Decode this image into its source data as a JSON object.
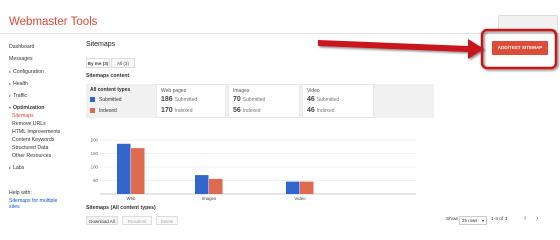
{
  "app": {
    "title": "Webmaster Tools",
    "accent": "#dd4b39",
    "link_color": "#1155cc"
  },
  "sidebar": {
    "items": [
      {
        "label": "Dashboard",
        "kind": "top"
      },
      {
        "label": "Messages",
        "kind": "top"
      },
      {
        "label": "Configuration",
        "kind": "caret"
      },
      {
        "label": "Health",
        "kind": "caret"
      },
      {
        "label": "Traffic",
        "kind": "caret"
      },
      {
        "label": "Optimization",
        "kind": "open"
      },
      {
        "label": "Sitemaps",
        "kind": "sub-active"
      },
      {
        "label": "Remove URLs",
        "kind": "sub"
      },
      {
        "label": "HTML Improvements",
        "kind": "sub"
      },
      {
        "label": "Content Keywords",
        "kind": "sub"
      },
      {
        "label": "Structured Data",
        "kind": "sub"
      },
      {
        "label": "Other Resources",
        "kind": "sub"
      },
      {
        "label": "Labs",
        "kind": "caret"
      }
    ],
    "help_title": "Help with:",
    "help_link": "Sitemaps for multiple sites"
  },
  "main": {
    "title": "Sitemaps",
    "add_button": "ADD/TEST SITEMAP",
    "tabs": [
      {
        "label": "By me (3)",
        "active": true
      },
      {
        "label": "All (3)",
        "active": false
      }
    ],
    "content_label": "Sitemaps content",
    "legend": {
      "header": "All content types",
      "submitted": "Submitted",
      "indexed": "Indexed",
      "submitted_color": "#3366cc",
      "indexed_color": "#dc6b4f"
    },
    "stats": [
      {
        "header": "Web pages",
        "submitted": "186",
        "indexed": "170",
        "submitted_label": "Submitted",
        "indexed_label": "Indexed"
      },
      {
        "header": "Images",
        "submitted": "70",
        "indexed": "56",
        "submitted_label": "Submitted",
        "indexed_label": "Indexed"
      },
      {
        "header": "Video",
        "submitted": "46",
        "indexed": "46",
        "submitted_label": "Submitted",
        "indexed_label": "Indexed"
      }
    ],
    "all_types_label": "Sitemaps (All content types)",
    "buttons": {
      "download": "Download All",
      "resubmit": "Resubmit",
      "delete": "Delete"
    },
    "pager": {
      "show_label": "Show",
      "rows_value": "25 rows",
      "range": "1-3 of 3"
    }
  },
  "chart_data": {
    "type": "bar",
    "categories": [
      "Web",
      "Images",
      "Video"
    ],
    "series": [
      {
        "name": "Submitted",
        "values": [
          186,
          70,
          46
        ],
        "color": "#3366cc"
      },
      {
        "name": "Indexed",
        "values": [
          170,
          56,
          46
        ],
        "color": "#dc6b4f"
      }
    ],
    "yticks": [
      50,
      100,
      150,
      200
    ],
    "ylim": [
      0,
      200
    ],
    "grid": true
  }
}
